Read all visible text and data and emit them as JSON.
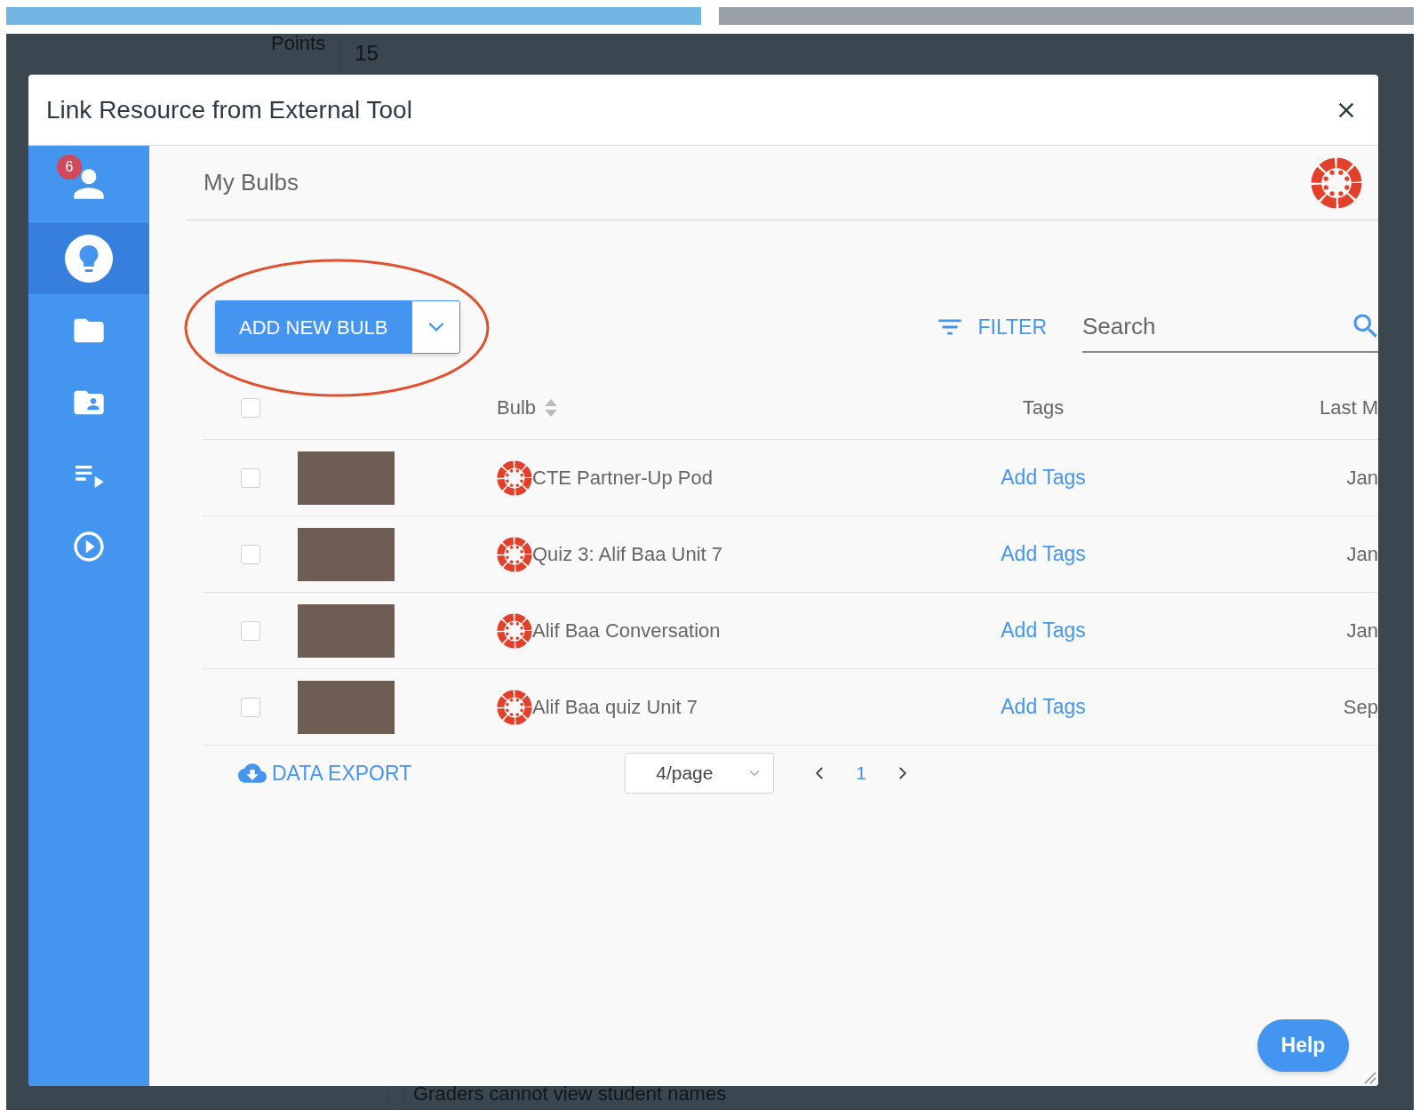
{
  "top_bars": [
    {
      "selected": true
    },
    {
      "selected": false
    }
  ],
  "background": {
    "points_label": "Points",
    "points_value": "15",
    "option_label": "Graders cannot view student names",
    "option_checked": false
  },
  "dialog": {
    "title": "Link Resource from External Tool"
  },
  "sidebar": {
    "items": [
      {
        "kind": "user",
        "badge": "6",
        "selected": false
      },
      {
        "kind": "bulb",
        "selected": true
      },
      {
        "kind": "folder",
        "selected": false
      },
      {
        "kind": "shared-folder",
        "selected": false
      },
      {
        "kind": "playlist",
        "selected": false
      },
      {
        "kind": "play",
        "selected": false
      }
    ]
  },
  "header": {
    "title": "My Bulbs"
  },
  "toolbar": {
    "add_button": "ADD NEW BULB",
    "filter": "FILTER",
    "search": {
      "placeholder": "Search"
    }
  },
  "table": {
    "all_checked": false,
    "columns": [
      "Bulb",
      "Tags",
      "Last M"
    ],
    "rows": [
      {
        "checked": false,
        "name": "CTE Partner-Up Pod",
        "tags": "Add Tags",
        "date": "Jan"
      },
      {
        "checked": false,
        "name": "Quiz 3: Alif Baa Unit 7",
        "tags": "Add Tags",
        "date": "Jan"
      },
      {
        "checked": false,
        "name": "Alif Baa Conversation",
        "tags": "Add Tags",
        "date": "Jan"
      },
      {
        "checked": false,
        "name": "Alif Baa quiz Unit 7",
        "tags": "Add Tags",
        "date": "Sep"
      }
    ]
  },
  "footer": {
    "export": "DATA EXPORT",
    "page_size": "4/page",
    "pages": [
      {
        "label": "1",
        "selected": true
      }
    ]
  },
  "help": "Help"
}
